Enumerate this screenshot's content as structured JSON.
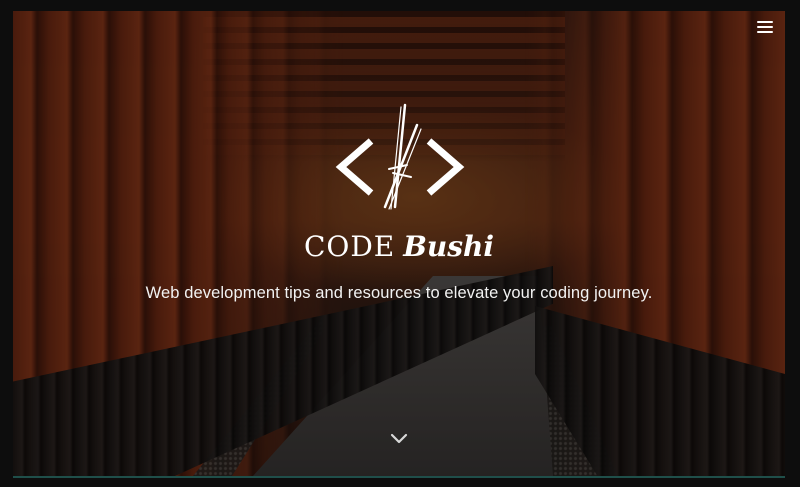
{
  "header": {
    "menu_icon": "hamburger-menu-icon"
  },
  "hero": {
    "logo_icon": "code-brackets-swords-icon",
    "brand_part1": "CODE",
    "brand_part2": "Bushi",
    "tagline": "Web development tips and resources to elevate your coding journey.",
    "scroll_icon": "chevron-down-icon"
  },
  "colors": {
    "text": "#ffffff",
    "frame": "#0d0d0d",
    "accent_border": "#1f4f4a"
  }
}
